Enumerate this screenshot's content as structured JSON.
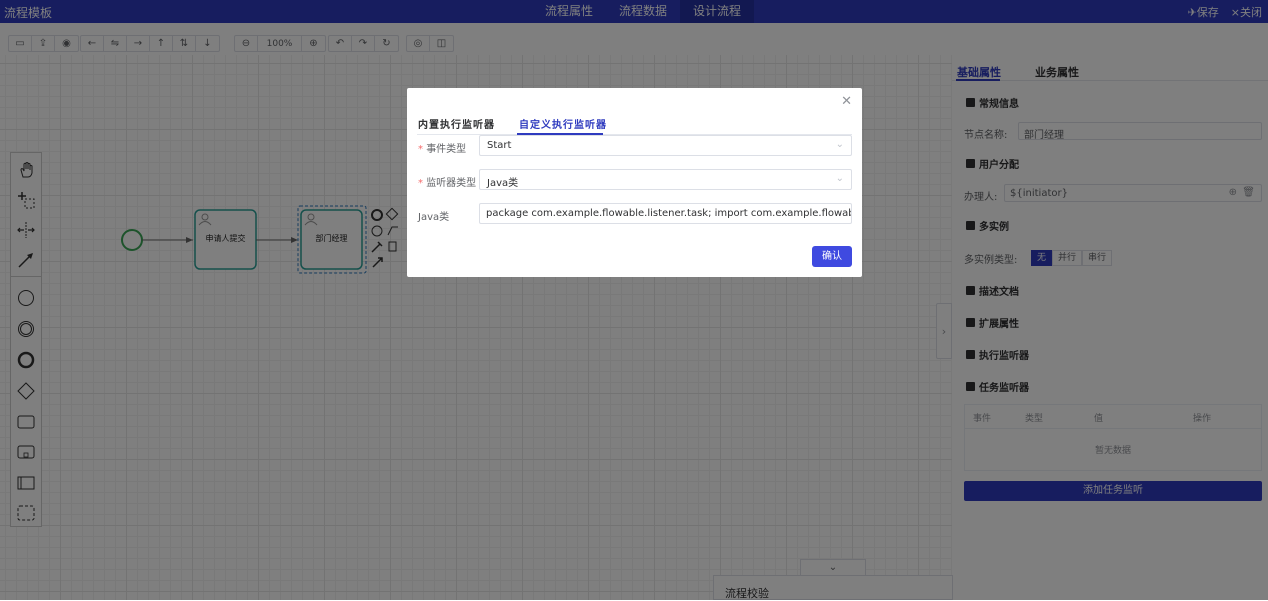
{
  "app": {
    "title": "流程模板"
  },
  "header_tabs": [
    {
      "label": "流程属性"
    },
    {
      "label": "流程数据"
    },
    {
      "label": "设计流程"
    }
  ],
  "header_actions": {
    "save": "保存",
    "close": "关闭"
  },
  "toolbar": {
    "zoom": "100%"
  },
  "diagram": {
    "task1": "申请人提交",
    "task2": "部门经理"
  },
  "right_panel": {
    "tabs": [
      "基础属性",
      "业务属性"
    ],
    "sections": {
      "general": "常规信息",
      "user": "用户分配",
      "multi": "多实例",
      "doc": "描述文档",
      "ext": "扩展属性",
      "exec_listener": "执行监听器",
      "task_listener": "任务监听器"
    },
    "node_name_label": "节点名称:",
    "node_name_value": "部门经理",
    "assignee_label": "办理人:",
    "assignee_value": "${initiator}",
    "multi_label": "多实例类型:",
    "multi_options": [
      "无",
      "并行",
      "串行"
    ],
    "table_headers": [
      "事件",
      "类型",
      "值",
      "操作"
    ],
    "table_empty": "暂无数据",
    "add_button": "添加任务监听"
  },
  "validation": {
    "label": "流程校验"
  },
  "dialog": {
    "tabs": [
      "内置执行监听器",
      "自定义执行监听器"
    ],
    "event_type_label": "事件类型",
    "event_type_value": "Start",
    "listener_type_label": "监听器类型",
    "listener_type_value": "Java类",
    "java_label": "Java类",
    "java_value": "package com.example.flowable.listener.task;  import com.example.flowable.service.We",
    "confirm": "确认"
  },
  "colors": {
    "accent": "#2f3bbf",
    "task_border": "#2aa198",
    "start_event": "#3aa757"
  }
}
